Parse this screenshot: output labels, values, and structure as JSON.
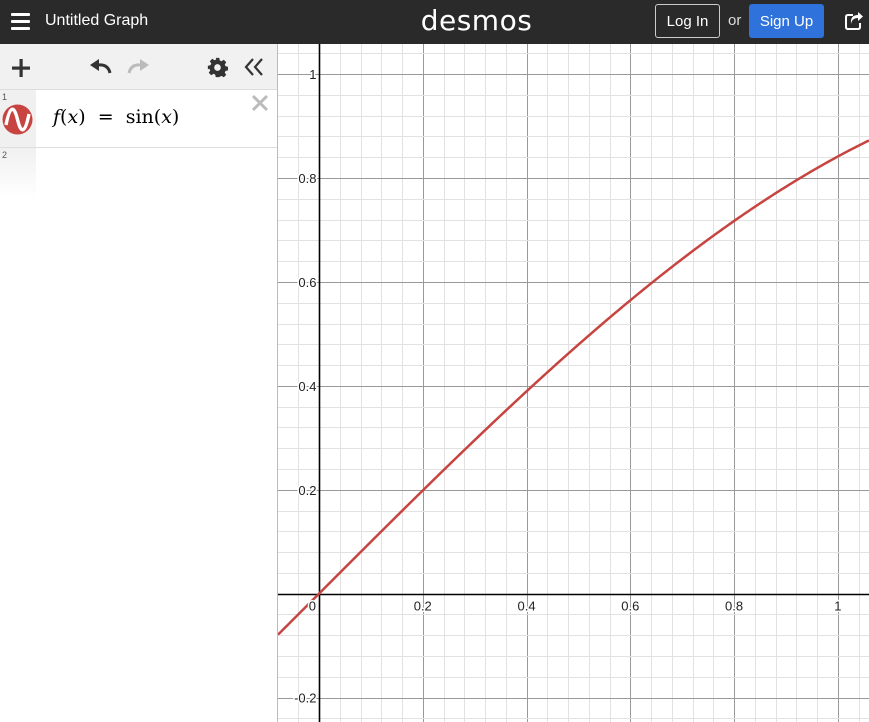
{
  "header": {
    "title": "Untitled Graph",
    "logo": "desmos",
    "login_label": "Log In",
    "or_text": "or",
    "signup_label": "Sign Up",
    "icons": [
      "hamburger-menu-icon",
      "share-icon"
    ]
  },
  "toolbar": {
    "icons": [
      "add-icon",
      "undo-icon",
      "redo-icon",
      "gear-icon",
      "collapse-icon"
    ]
  },
  "expressions": [
    {
      "index": "1",
      "color": "#c74440",
      "f": "f",
      "x": "x",
      "eq": "=",
      "fn": "sin"
    },
    {
      "index": "2"
    }
  ],
  "chart_data": {
    "type": "line",
    "series": [
      {
        "expression": "sin(x)",
        "color": "#c74440"
      }
    ],
    "xlim": [
      -0.079,
      1.06
    ],
    "ylim": [
      -0.247,
      1.058
    ],
    "x_ticks": [
      "0",
      "0.2",
      "0.4",
      "0.6",
      "0.8",
      "1"
    ],
    "y_ticks": [
      "1",
      "0.8",
      "0.6",
      "0.4",
      "0.2",
      "-0.2"
    ],
    "grid": true
  }
}
